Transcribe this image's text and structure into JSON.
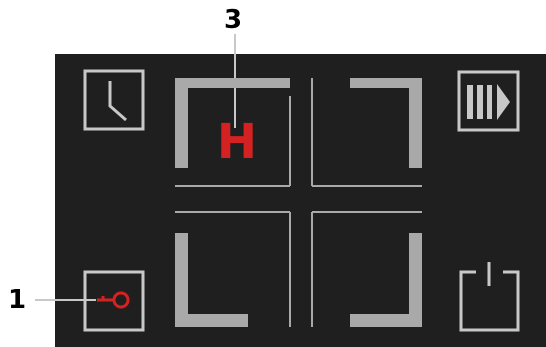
{
  "callouts": {
    "one": "1",
    "three": "3"
  },
  "zones": {
    "top_left_letter": "H"
  },
  "icons": {
    "timer": "clock-icon",
    "boost": "boost-icon",
    "lock": "key-lock-icon",
    "power": "power-icon"
  },
  "colors": {
    "panel_background": "#1f1f1f",
    "outline_light": "#c8c8c8",
    "zone_frame": "#a9a9a9",
    "active_red": "#d42222"
  }
}
